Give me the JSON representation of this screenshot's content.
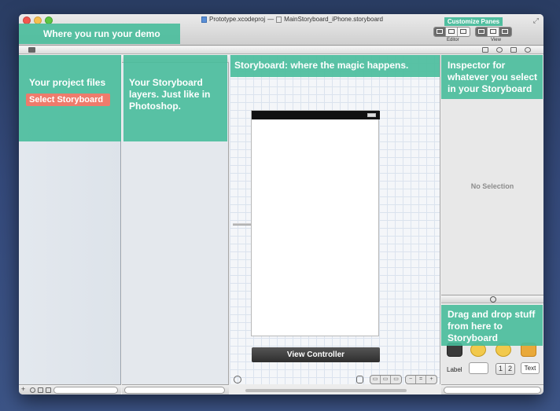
{
  "window": {
    "project_name": "Prototype.xcodeproj",
    "separator": "—",
    "storyboard_name": "MainStoryboard_iPhone.storyboard"
  },
  "toolbar": {
    "editor_label": "Editor",
    "view_label": "View",
    "customize_panes": "Customize Panes"
  },
  "overlays": {
    "run_demo": "Where you run your demo",
    "project_files": "Your project files",
    "select_storyboard": "Select Storyboard",
    "storyboard_layers": "Your Storyboard layers. Just like in Photoshop.",
    "storyboard_magic": "Storyboard: where the magic happens.",
    "inspector": "Inspector for whatever you select in your Storyboard",
    "drag_drop": "Drag and drop stuff from here to Storyboard"
  },
  "inspector": {
    "empty_state": "No Selection"
  },
  "canvas": {
    "scene_label": "View Controller"
  },
  "library": {
    "label_item": "Label",
    "segment_1": "1",
    "segment_2": "2",
    "text_item": "Text"
  },
  "colors": {
    "overlay_green": "#48bc9b",
    "highlight_red": "#ef7b6c"
  }
}
